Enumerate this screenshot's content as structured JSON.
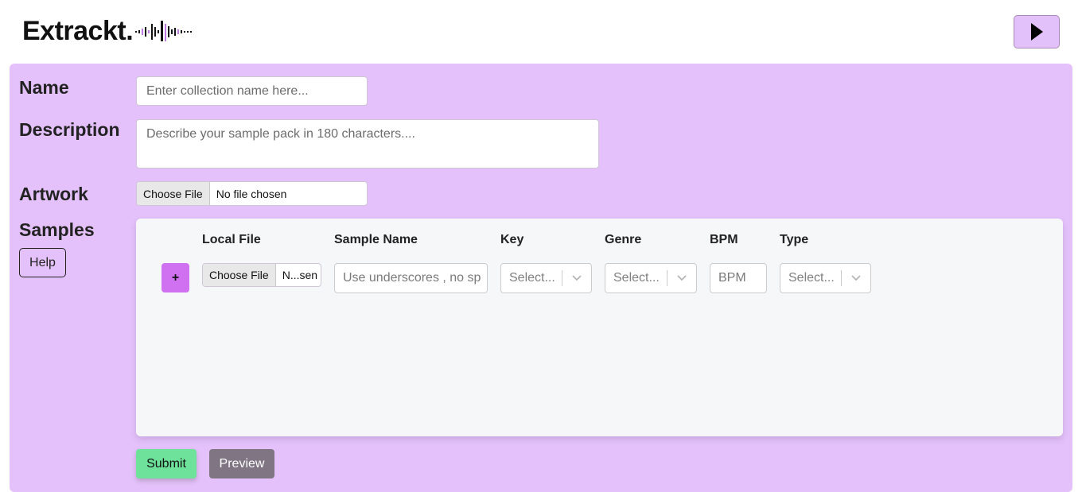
{
  "header": {
    "brand": "Extrackt.",
    "logo_icon": "waveform-icon",
    "play_icon": "play-icon"
  },
  "form": {
    "name_label": "Name",
    "name_placeholder": "Enter collection name here...",
    "description_label": "Description",
    "description_placeholder": "Describe your sample pack in 180 characters....",
    "artwork_label": "Artwork",
    "artwork_button": "Choose File",
    "artwork_status": "No file chosen",
    "samples_label": "Samples",
    "help_label": "Help"
  },
  "samples": {
    "columns": [
      "Local File",
      "Sample Name",
      "Key",
      "Genre",
      "BPM",
      "Type"
    ],
    "row": {
      "add_label": "+",
      "file_button": "Choose File",
      "file_status": "N...sen",
      "name_placeholder": "Use underscores , no sp",
      "key_value": "Select...",
      "genre_value": "Select...",
      "bpm_placeholder": "BPM",
      "type_value": "Select..."
    }
  },
  "actions": {
    "submit_label": "Submit",
    "preview_label": "Preview"
  },
  "colors": {
    "panel": "#e4c1fa",
    "accent": "#cf71f0",
    "submit": "#6ee29b",
    "preview": "#807683"
  }
}
